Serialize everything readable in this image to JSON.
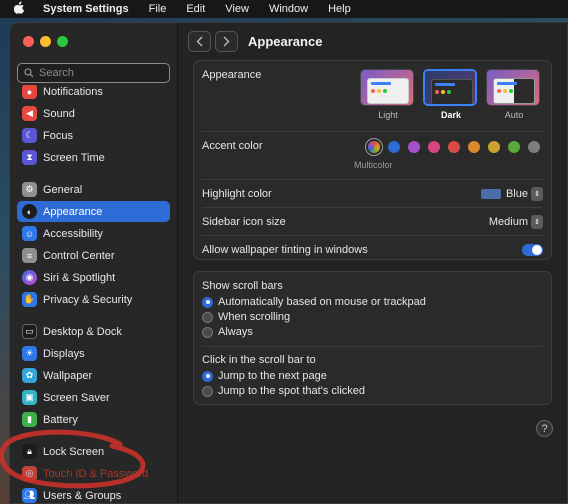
{
  "menubar": {
    "apple_icon": "apple-logo-icon",
    "items": [
      "System Settings",
      "File",
      "Edit",
      "View",
      "Window",
      "Help"
    ]
  },
  "search": {
    "placeholder": "Search"
  },
  "sidebar": {
    "items": [
      {
        "label": "Notifications",
        "icon": "bell-icon",
        "color": "#e5483f"
      },
      {
        "label": "Sound",
        "icon": "speaker-icon",
        "color": "#e5483f"
      },
      {
        "label": "Focus",
        "icon": "moon-icon",
        "color": "#5b56d6"
      },
      {
        "label": "Screen Time",
        "icon": "hourglass-icon",
        "color": "#5b56d6"
      },
      {
        "label": "General",
        "icon": "gear-icon",
        "color": "#8e8e93"
      },
      {
        "label": "Appearance",
        "icon": "appearance-icon",
        "color": "#1c1c1c"
      },
      {
        "label": "Accessibility",
        "icon": "accessibility-icon",
        "color": "#2f78e8"
      },
      {
        "label": "Control Center",
        "icon": "control-center-icon",
        "color": "#8e8e93"
      },
      {
        "label": "Siri & Spotlight",
        "icon": "siri-icon",
        "color": "#b64ad8"
      },
      {
        "label": "Privacy & Security",
        "icon": "hand-icon",
        "color": "#2f78e8"
      },
      {
        "label": "Desktop & Dock",
        "icon": "dock-icon",
        "color": "#1c1c1c"
      },
      {
        "label": "Displays",
        "icon": "sun-icon",
        "color": "#2f78e8"
      },
      {
        "label": "Wallpaper",
        "icon": "flower-icon",
        "color": "#35a4d8"
      },
      {
        "label": "Screen Saver",
        "icon": "screensaver-icon",
        "color": "#35b4c8"
      },
      {
        "label": "Battery",
        "icon": "battery-icon",
        "color": "#3cb04a"
      },
      {
        "label": "Lock Screen",
        "icon": "lock-icon",
        "color": "#1c1c1c"
      },
      {
        "label": "Touch ID & Password",
        "icon": "fingerprint-icon",
        "color": "#e5483f"
      },
      {
        "label": "Users & Groups",
        "icon": "users-icon",
        "color": "#2f78e8"
      }
    ],
    "selected": "Appearance"
  },
  "header": {
    "title": "Appearance"
  },
  "appearance": {
    "label": "Appearance",
    "options": [
      {
        "label": "Light",
        "selected": false
      },
      {
        "label": "Dark",
        "selected": true
      },
      {
        "label": "Auto",
        "selected": false
      }
    ]
  },
  "accent": {
    "label": "Accent color",
    "selected_caption": "Multicolor",
    "colors": [
      "multicolor",
      "#2f6bd6",
      "#a550c8",
      "#d6457f",
      "#d84b45",
      "#d98a2c",
      "#c9a12c",
      "#5aa83a",
      "#7d7d7d"
    ]
  },
  "highlight": {
    "label": "Highlight color",
    "value": "Blue",
    "swatch": "#4a6ea8"
  },
  "sidebar_icon_size": {
    "label": "Sidebar icon size",
    "value": "Medium"
  },
  "wallpaper_tinting": {
    "label": "Allow wallpaper tinting in windows",
    "enabled": true
  },
  "scroll_bars": {
    "label": "Show scroll bars",
    "options": [
      {
        "label": "Automatically based on mouse or trackpad",
        "selected": true
      },
      {
        "label": "When scrolling",
        "selected": false
      },
      {
        "label": "Always",
        "selected": false
      }
    ]
  },
  "scroll_click": {
    "label": "Click in the scroll bar to",
    "options": [
      {
        "label": "Jump to the next page",
        "selected": true
      },
      {
        "label": "Jump to the spot that's clicked",
        "selected": false
      }
    ]
  },
  "help": {
    "label": "?"
  },
  "annotation_color": "#c8322a"
}
